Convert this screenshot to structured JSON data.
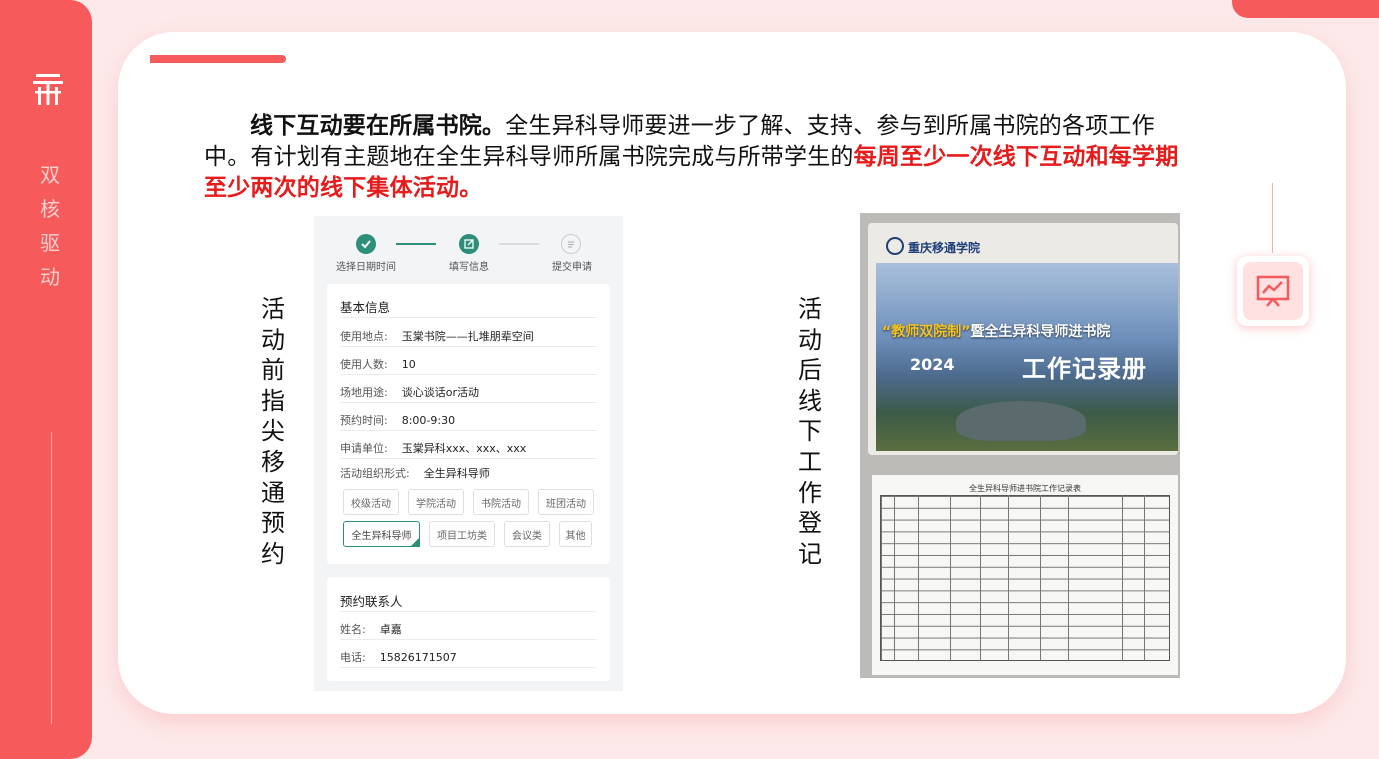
{
  "sidebar": {
    "title_chars": [
      "双",
      "核",
      "驱",
      "动"
    ]
  },
  "paragraph": {
    "bold_lead": "线下互动要在所属书院。",
    "body": "全生异科导师要进一步了解、支持、参与到所属书院的各项工作中。有计划有主题地在全生异科导师所属书院完成与所带学生的",
    "highlight": "每周至少一次线下互动和每学期至少两次的线下集体活动。"
  },
  "labels": {
    "before_chars": [
      "活",
      "动",
      "前",
      "指",
      "尖",
      "移",
      "通",
      "预",
      "约"
    ],
    "after_chars": [
      "活",
      "动",
      "后",
      "线",
      "下",
      "工",
      "作",
      "登",
      "记"
    ]
  },
  "booking_form": {
    "steps": [
      {
        "label": "选择日期时间",
        "state": "done"
      },
      {
        "label": "填写信息",
        "state": "current"
      },
      {
        "label": "提交申请",
        "state": "todo"
      }
    ],
    "basic_info": {
      "title": "基本信息",
      "fields": [
        {
          "key": "使用地点:",
          "value": "玉棠书院——扎堆朋辈空间"
        },
        {
          "key": "使用人数:",
          "value": "10"
        },
        {
          "key": "场地用途:",
          "value": "谈心谈话or活动"
        },
        {
          "key": "预约时间:",
          "value": "8:00-9:30"
        },
        {
          "key": "申请单位:",
          "value": "玉棠异科xxx、xxx、xxx"
        },
        {
          "key": "活动组织形式:",
          "value": "全生异科导师"
        }
      ],
      "chips": [
        "校级活动",
        "学院活动",
        "书院活动",
        "班团活动",
        "全生异科导师",
        "项目工坊类",
        "会议类",
        "其他"
      ],
      "selected_chip": "全生异科导师"
    },
    "contact": {
      "title": "预约联系人",
      "name_key": "姓名:",
      "name_value": "卓嘉",
      "phone_key": "电话:",
      "phone_value": "15826171507"
    }
  },
  "booklet": {
    "school": "重庆移通学院",
    "slogan_quote": "“教师双院制”",
    "slogan_rest": "暨全生异科导师进书院",
    "year": "2024",
    "book_title": "工作记录册",
    "sheet_title": "全生异科导师进书院工作记录表"
  },
  "colors": {
    "brand_red": "#f65a5b",
    "highlight_red": "#e61b1b",
    "teal": "#2d8f7a"
  }
}
